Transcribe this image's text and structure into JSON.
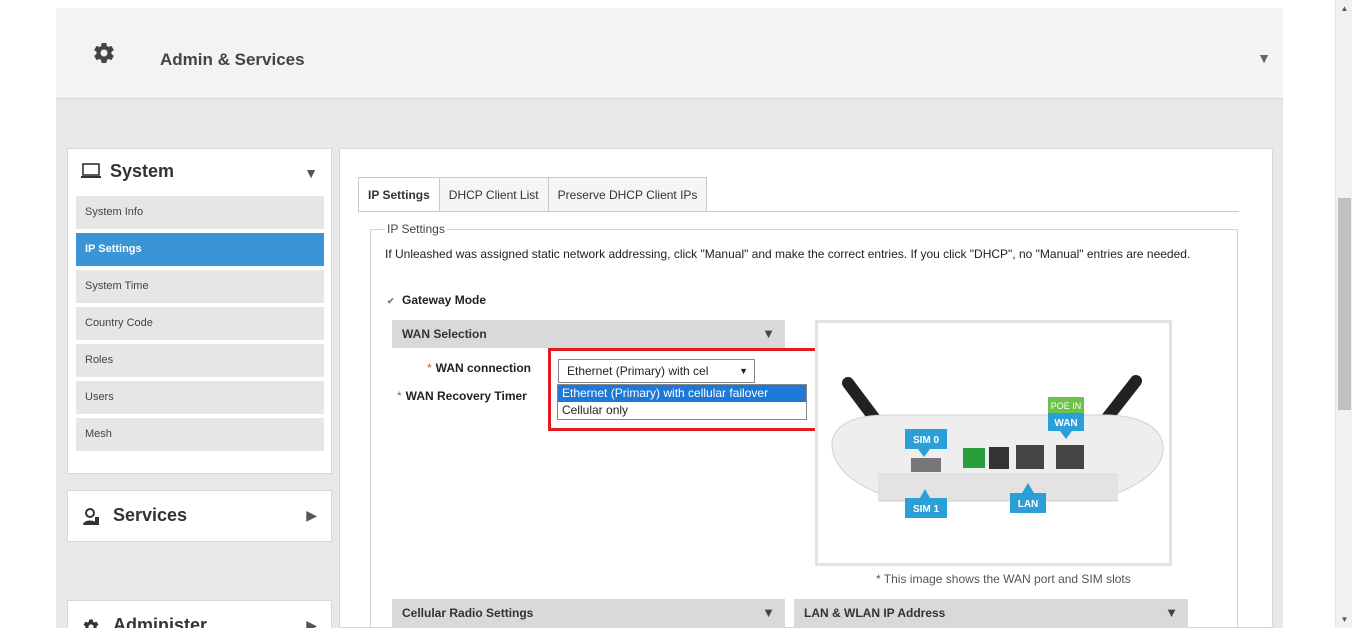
{
  "header": {
    "title": "Admin & Services",
    "icon": "gear-icon"
  },
  "sidebar": {
    "system_label": "System",
    "items": [
      {
        "label": "System Info",
        "active": false
      },
      {
        "label": "IP Settings",
        "active": true
      },
      {
        "label": "System Time",
        "active": false
      },
      {
        "label": "Country Code",
        "active": false
      },
      {
        "label": "Roles",
        "active": false
      },
      {
        "label": "Users",
        "active": false
      },
      {
        "label": "Mesh",
        "active": false
      }
    ],
    "services_label": "Services",
    "administer_label": "Administer"
  },
  "tabs": [
    {
      "label": "IP Settings",
      "active": true
    },
    {
      "label": "DHCP Client List",
      "active": false
    },
    {
      "label": "Preserve DHCP Client IPs",
      "active": false
    }
  ],
  "ip_settings": {
    "legend": "IP Settings",
    "description": "If Unleashed was assigned static network addressing, click \"Manual\" and make the correct entries. If you click \"DHCP\", no \"Manual\" entries are needed.",
    "gateway_mode_label": "Gateway Mode",
    "wan_selection_label": "WAN Selection",
    "wan_connection_label": "WAN connection",
    "wan_recovery_label": "WAN Recovery Timer",
    "required_mark": "*",
    "wan_connection_value": "Ethernet (Primary) with cel",
    "wan_options": [
      "Ethernet (Primary) with cellular failover",
      "Cellular only"
    ],
    "image_caption": "* This image shows the WAN port and SIM slots",
    "device_labels": {
      "sim0": "SIM 0",
      "sim1": "SIM 1",
      "lan": "LAN",
      "wan": "WAN",
      "poe_in": "POE IN"
    },
    "cellular_radio_label": "Cellular Radio Settings",
    "lan_wlan_label": "LAN & WLAN IP Address"
  },
  "colors": {
    "accent": "#3a94d6",
    "highlight_box": "#e31b23",
    "dropdown_selected": "#1e78d7"
  }
}
